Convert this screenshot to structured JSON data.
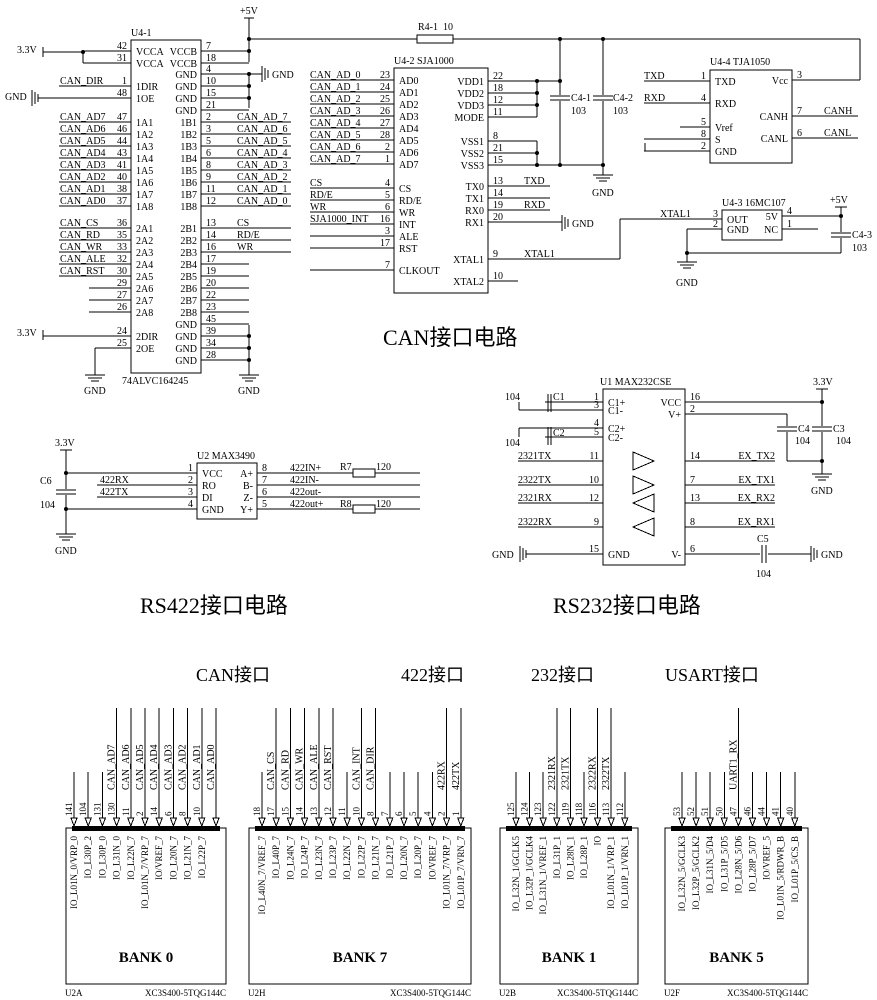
{
  "titles": {
    "can_circuit": "CAN接口电路",
    "rs422_circuit": "RS422接口电路",
    "rs232_circuit": "RS232接口电路",
    "can_port": "CAN接口",
    "p422_port": "422接口",
    "p232_port": "232接口",
    "usart_port": "USART接口"
  },
  "power": {
    "v33": "3.3V",
    "v5": "+5V",
    "gnd": "GND"
  },
  "u41": {
    "ref": "U4-1",
    "part": "74ALVC164245",
    "left_pins": [
      {
        "num": "42",
        "net": "",
        "name": "VCCA"
      },
      {
        "num": "31",
        "net": "",
        "name": "VCCA"
      },
      {
        "num": "1",
        "net": "CAN_DIR",
        "name": "1DIR"
      },
      {
        "num": "48",
        "net": "",
        "name": "1OE"
      },
      {
        "num": "47",
        "net": "CAN_AD7",
        "name": "1A1"
      },
      {
        "num": "46",
        "net": "CAN_AD6",
        "name": "1A2"
      },
      {
        "num": "44",
        "net": "CAN_AD5",
        "name": "1A3"
      },
      {
        "num": "43",
        "net": "CAN_AD4",
        "name": "1A4"
      },
      {
        "num": "41",
        "net": "CAN_AD3",
        "name": "1A5"
      },
      {
        "num": "40",
        "net": "CAN_AD2",
        "name": "1A6"
      },
      {
        "num": "38",
        "net": "CAN_AD1",
        "name": "1A7"
      },
      {
        "num": "37",
        "net": "CAN_AD0",
        "name": "1A8"
      },
      {
        "num": "36",
        "net": "CAN_CS",
        "name": "2A1"
      },
      {
        "num": "35",
        "net": "CAN_RD",
        "name": "2A2"
      },
      {
        "num": "33",
        "net": "CAN_WR",
        "name": "2A3"
      },
      {
        "num": "32",
        "net": "CAN_ALE",
        "name": "2A4"
      },
      {
        "num": "30",
        "net": "CAN_RST",
        "name": "2A5"
      },
      {
        "num": "29",
        "net": "",
        "name": "2A6"
      },
      {
        "num": "27",
        "net": "",
        "name": "2A7"
      },
      {
        "num": "26",
        "net": "",
        "name": "2A8"
      },
      {
        "num": "24",
        "net": "",
        "name": "2DIR"
      },
      {
        "num": "25",
        "net": "",
        "name": "2OE"
      }
    ],
    "right_pins": [
      {
        "num": "7",
        "net": "",
        "name": "VCCB"
      },
      {
        "num": "18",
        "net": "",
        "name": "VCCB"
      },
      {
        "num": "4",
        "net": "",
        "name": "GND"
      },
      {
        "num": "10",
        "net": "",
        "name": "GND"
      },
      {
        "num": "15",
        "net": "",
        "name": "GND"
      },
      {
        "num": "21",
        "net": "",
        "name": "GND"
      },
      {
        "num": "2",
        "net": "CAN_AD_7",
        "name": "1B1"
      },
      {
        "num": "3",
        "net": "CAN_AD_6",
        "name": "1B2"
      },
      {
        "num": "5",
        "net": "CAN_AD_5",
        "name": "1B3"
      },
      {
        "num": "6",
        "net": "CAN_AD_4",
        "name": "1B4"
      },
      {
        "num": "8",
        "net": "CAN_AD_3",
        "name": "1B5"
      },
      {
        "num": "9",
        "net": "CAN_AD_2",
        "name": "1B6"
      },
      {
        "num": "11",
        "net": "CAN_AD_1",
        "name": "1B7"
      },
      {
        "num": "12",
        "net": "CAN_AD_0",
        "name": "1B8"
      },
      {
        "num": "13",
        "net": "CS",
        "name": "2B1"
      },
      {
        "num": "14",
        "net": "RD/E",
        "name": "2B2"
      },
      {
        "num": "16",
        "net": "WR",
        "name": "2B3"
      },
      {
        "num": "17",
        "net": "",
        "name": "2B4"
      },
      {
        "num": "19",
        "net": "",
        "name": "2B5"
      },
      {
        "num": "20",
        "net": "",
        "name": "2B6"
      },
      {
        "num": "22",
        "net": "",
        "name": "2B7"
      },
      {
        "num": "23",
        "net": "",
        "name": "2B8"
      },
      {
        "num": "45",
        "net": "",
        "name": "GND"
      },
      {
        "num": "39",
        "net": "",
        "name": "GND"
      },
      {
        "num": "34",
        "net": "",
        "name": "GND"
      },
      {
        "num": "28",
        "net": "",
        "name": "GND"
      }
    ]
  },
  "r41": {
    "ref": "R4-1",
    "value": "10"
  },
  "u42": {
    "ref": "U4-2 SJA1000",
    "left_pins": [
      {
        "num": "23",
        "net": "CAN_AD_0",
        "name": "AD0"
      },
      {
        "num": "24",
        "net": "CAN_AD_1",
        "name": "AD1"
      },
      {
        "num": "25",
        "net": "CAN_AD_2",
        "name": "AD2"
      },
      {
        "num": "26",
        "net": "CAN_AD_3",
        "name": "AD3"
      },
      {
        "num": "27",
        "net": "CAN_AD_4",
        "name": "AD4"
      },
      {
        "num": "28",
        "net": "CAN_AD_5",
        "name": "AD5"
      },
      {
        "num": "2",
        "net": "CAN_AD_6",
        "name": "AD6"
      },
      {
        "num": "1",
        "net": "CAN_AD_7",
        "name": "AD7"
      },
      {
        "num": "4",
        "net": "CS",
        "name": "CS"
      },
      {
        "num": "5",
        "net": "RD/E",
        "name": "RD/E"
      },
      {
        "num": "6",
        "net": "WR",
        "name": "WR"
      },
      {
        "num": "16",
        "net": "SJA1000_INT",
        "name": "INT"
      },
      {
        "num": "3",
        "net": "",
        "name": "ALE"
      },
      {
        "num": "17",
        "net": "",
        "name": "RST"
      },
      {
        "num": "7",
        "net": "",
        "name": "CLKOUT"
      }
    ],
    "right_pins": [
      {
        "num": "22",
        "net": "",
        "name": "VDD1"
      },
      {
        "num": "18",
        "net": "",
        "name": "VDD2"
      },
      {
        "num": "12",
        "net": "",
        "name": "VDD3"
      },
      {
        "num": "11",
        "net": "",
        "name": "MODE"
      },
      {
        "num": "8",
        "net": "",
        "name": "VSS1"
      },
      {
        "num": "21",
        "net": "",
        "name": "VSS2"
      },
      {
        "num": "15",
        "net": "",
        "name": "VSS3"
      },
      {
        "num": "13",
        "net": "TXD",
        "name": "TX0"
      },
      {
        "num": "14",
        "net": "",
        "name": "TX1"
      },
      {
        "num": "19",
        "net": "RXD",
        "name": "RX0"
      },
      {
        "num": "20",
        "net": "",
        "name": "RX1"
      },
      {
        "num": "9",
        "net": "XTAL1",
        "name": "XTAL1"
      },
      {
        "num": "10",
        "net": "",
        "name": "XTAL2"
      }
    ]
  },
  "c41": {
    "ref": "C4-1",
    "value": "103"
  },
  "c42": {
    "ref": "C4-2",
    "value": "103"
  },
  "u44": {
    "ref": "U4-4  TJA1050",
    "left_pins": [
      {
        "num": "1",
        "net": "TXD",
        "name": "TXD"
      },
      {
        "num": "4",
        "net": "RXD",
        "name": "RXD"
      },
      {
        "num": "5",
        "net": "",
        "name": "Vref"
      },
      {
        "num": "8",
        "net": "",
        "name": "S"
      },
      {
        "num": "2",
        "net": "",
        "name": "GND"
      }
    ],
    "right_pins": [
      {
        "num": "3",
        "net": "",
        "name": "Vcc"
      },
      {
        "num": "7",
        "net": "CANH",
        "name": "CANH"
      },
      {
        "num": "6",
        "net": "CANL",
        "name": "CANL"
      }
    ]
  },
  "u43": {
    "ref": "U4-3 16MC107",
    "left_pins": [
      {
        "num": "3",
        "net": "XTAL1",
        "name": "OUT"
      },
      {
        "num": "2",
        "net": "",
        "name": "GND"
      }
    ],
    "right_pins": [
      {
        "num": "4",
        "net": "",
        "name": "5V"
      },
      {
        "num": "1",
        "net": "",
        "name": "NC"
      }
    ]
  },
  "c43": {
    "ref": "C4-3",
    "value": "103"
  },
  "u2": {
    "ref": "U2  MAX3490",
    "left_pins": [
      {
        "num": "1",
        "net": "",
        "name": "VCC"
      },
      {
        "num": "2",
        "net": "422RX",
        "name": "RO"
      },
      {
        "num": "3",
        "net": "422TX",
        "name": "DI"
      },
      {
        "num": "4",
        "net": "",
        "name": "GND"
      }
    ],
    "right_pins": [
      {
        "num": "8",
        "net": "422IN+",
        "name": "A+"
      },
      {
        "num": "7",
        "net": "422IN-",
        "name": "B-"
      },
      {
        "num": "6",
        "net": "422out-",
        "name": "Z-"
      },
      {
        "num": "5",
        "net": "422out+",
        "name": "Y+"
      }
    ]
  },
  "c6": {
    "ref": "C6",
    "value": "104"
  },
  "r7": {
    "ref": "R7",
    "value": "120"
  },
  "r8": {
    "ref": "R8",
    "value": "120"
  },
  "u1": {
    "ref": "U1  MAX232CSE",
    "left_pins": [
      {
        "num": "1",
        "net": "",
        "name": "C1+"
      },
      {
        "num": "3",
        "net": "",
        "name": "C1-"
      },
      {
        "num": "4",
        "net": "",
        "name": "C2+"
      },
      {
        "num": "5",
        "net": "",
        "name": "C2-"
      },
      {
        "num": "11",
        "net": "2321TX",
        "name": ""
      },
      {
        "num": "10",
        "net": "2322TX",
        "name": ""
      },
      {
        "num": "12",
        "net": "2321RX",
        "name": ""
      },
      {
        "num": "9",
        "net": "2322RX",
        "name": ""
      },
      {
        "num": "15",
        "net": "",
        "name": "GND"
      }
    ],
    "right_pins": [
      {
        "num": "16",
        "net": "",
        "name": "VCC"
      },
      {
        "num": "2",
        "net": "",
        "name": "V+"
      },
      {
        "num": "14",
        "net": "EX_TX2",
        "name": ""
      },
      {
        "num": "7",
        "net": "EX_TX1",
        "name": ""
      },
      {
        "num": "13",
        "net": "EX_RX2",
        "name": ""
      },
      {
        "num": "8",
        "net": "EX_RX1",
        "name": ""
      },
      {
        "num": "6",
        "net": "",
        "name": "V-"
      }
    ]
  },
  "c1": {
    "ref": "C1",
    "value": "104"
  },
  "c2": {
    "ref": "C2",
    "value": "104"
  },
  "c3": {
    "ref": "C3",
    "value": "104"
  },
  "c4": {
    "ref": "C4",
    "value": "104"
  },
  "c5": {
    "ref": "C5",
    "value": "104"
  },
  "banks": [
    {
      "ref": "U2A",
      "part": "XC3S400-5TQG144C",
      "label": "BANK 0",
      "pins": [
        {
          "num": "141",
          "net": "",
          "name": "IO_L01N_0/VRP_0"
        },
        {
          "num": "104",
          "net": "",
          "name": "IO_L30P_2"
        },
        {
          "num": "131",
          "net": "",
          "name": "IO_L30P_0"
        },
        {
          "num": "130",
          "net": "CAN_AD7",
          "name": "IO_L31N_0"
        },
        {
          "num": "11",
          "net": "CAN_AD6",
          "name": "IO_L22N_7"
        },
        {
          "num": "2",
          "net": "CAN_AD5",
          "name": "IO_L01N_7/VRP_7"
        },
        {
          "num": "14",
          "net": "CAN_AD4",
          "name": "IO/VREF_7"
        },
        {
          "num": "6",
          "net": "CAN_AD3",
          "name": "IO_L20N_7"
        },
        {
          "num": "8",
          "net": "CAN_AD2",
          "name": "IO_L21N_7"
        },
        {
          "num": "10",
          "net": "CAN_AD1",
          "name": "IO_L22P_7"
        },
        {
          "num": "",
          "net": "CAN_AD0",
          "name": ""
        }
      ]
    },
    {
      "ref": "U2H",
      "part": "XC3S400-5TQG144C",
      "label": "BANK 7",
      "pins": [
        {
          "num": "18",
          "net": "",
          "name": "IO_L40N_7/VREF_7"
        },
        {
          "num": "17",
          "net": "CAN_CS",
          "name": "IO_L40P_7"
        },
        {
          "num": "15",
          "net": "CAN_RD",
          "name": "IO_L24N_7"
        },
        {
          "num": "14",
          "net": "CAN_WR",
          "name": "IO_L24P_7"
        },
        {
          "num": "13",
          "net": "CAN_ALE",
          "name": "IO_L23N_7"
        },
        {
          "num": "12",
          "net": "CAN_RST",
          "name": "IO_L23P_7"
        },
        {
          "num": "11",
          "net": "",
          "name": "IO_L22N_7"
        },
        {
          "num": "10",
          "net": "CAN_INT",
          "name": "IO_L22P_7"
        },
        {
          "num": "8",
          "net": "CAN_DIR",
          "name": "IO_L21N_7"
        },
        {
          "num": "7",
          "net": "",
          "name": "IO_L21P_7"
        },
        {
          "num": "6",
          "net": "",
          "name": "IO_L20N_7"
        },
        {
          "num": "5",
          "net": "",
          "name": "IO_L20P_7"
        },
        {
          "num": "4",
          "net": "",
          "name": "IO/VREF_7"
        },
        {
          "num": "2",
          "net": "422RX",
          "name": "IO_L01N_7/VRP_7"
        },
        {
          "num": "1",
          "net": "422TX",
          "name": "IO_L01P_7/VRN_7"
        }
      ]
    },
    {
      "ref": "U2B",
      "part": "XC3S400-5TQG144C",
      "label": "BANK 1",
      "pins": [
        {
          "num": "125",
          "net": "",
          "name": "IO_L32N_1/GCLK5"
        },
        {
          "num": "124",
          "net": "",
          "name": "IO_L32P_1/GCLK4"
        },
        {
          "num": "123",
          "net": "",
          "name": "IO_L31N_1/VREF_1"
        },
        {
          "num": "122",
          "net": "2321RX",
          "name": "IO_L31P_1"
        },
        {
          "num": "119",
          "net": "2321TX",
          "name": "IO_L28N_1"
        },
        {
          "num": "118",
          "net": "",
          "name": "IO_L28P_1"
        },
        {
          "num": "116",
          "net": "2322RX",
          "name": "IO"
        },
        {
          "num": "113",
          "net": "2322TX",
          "name": "IO_L01N_1/VRP_1"
        },
        {
          "num": "112",
          "net": "",
          "name": "IO_L01P_1/VRN_1"
        }
      ]
    },
    {
      "ref": "U2F",
      "part": "XC3S400-5TQG144C",
      "label": "BANK 5",
      "pins": [
        {
          "num": "53",
          "net": "",
          "name": "IO_L32N_5/GCLK3"
        },
        {
          "num": "52",
          "net": "",
          "name": "IO_L32P_5/GCLK2"
        },
        {
          "num": "51",
          "net": "",
          "name": "IO_L31N_5/D4"
        },
        {
          "num": "50",
          "net": "",
          "name": "IO_L31P_5/D5"
        },
        {
          "num": "47",
          "net": "UART1_RX",
          "name": "IO_L28N_5/D6"
        },
        {
          "num": "46",
          "net": "",
          "name": "IO_L28P_5/D7"
        },
        {
          "num": "44",
          "net": "",
          "name": "IO/VREF_5"
        },
        {
          "num": "41",
          "net": "",
          "name": "IO_L01N_5/RDWR_B"
        },
        {
          "num": "40",
          "net": "",
          "name": "IO_L01P_5/CS_B"
        }
      ]
    }
  ]
}
